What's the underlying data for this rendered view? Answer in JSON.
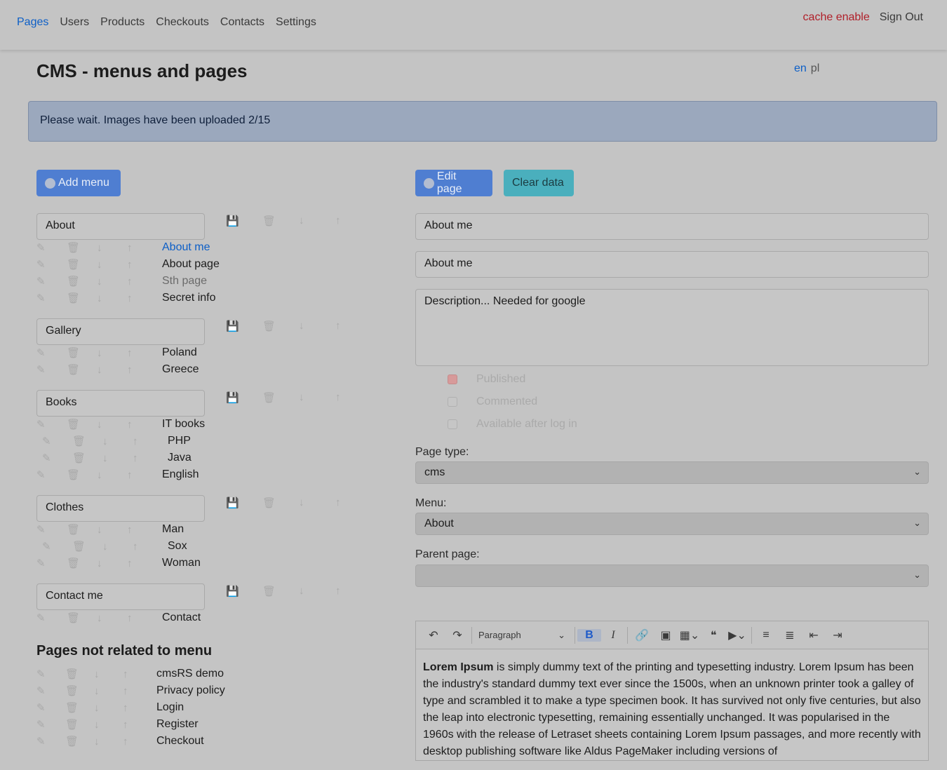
{
  "nav": {
    "items": [
      "Pages",
      "Users",
      "Products",
      "Checkouts",
      "Contacts",
      "Settings"
    ],
    "cache": "cache enable",
    "signout": "Sign Out"
  },
  "title": "CMS - menus and pages",
  "langs": {
    "en": "en",
    "pl": "pl"
  },
  "alert": "Please wait. Images have been uploaded 2/15",
  "buttons": {
    "add_menu": "Add menu",
    "edit_page": "Edit page",
    "clear_data": "Clear data"
  },
  "menus": [
    {
      "name": "About",
      "pages": [
        {
          "label": "About me",
          "style": "link"
        },
        {
          "label": "About page"
        },
        {
          "label": "Sth page",
          "style": "muted"
        },
        {
          "label": "Secret info"
        }
      ]
    },
    {
      "name": "Gallery",
      "pages": [
        {
          "label": "Poland"
        },
        {
          "label": "Greece"
        }
      ]
    },
    {
      "name": "Books",
      "pages": [
        {
          "label": "IT books"
        },
        {
          "label": "PHP",
          "child": true
        },
        {
          "label": "Java",
          "child": true
        },
        {
          "label": "English"
        }
      ]
    },
    {
      "name": "Clothes",
      "pages": [
        {
          "label": "Man"
        },
        {
          "label": "Sox",
          "child": true
        },
        {
          "label": "Woman"
        }
      ]
    },
    {
      "name": "Contact me",
      "pages": [
        {
          "label": "Contact"
        }
      ]
    }
  ],
  "unrelated_title": "Pages not related to menu",
  "unrelated_pages": [
    "cmsRS demo",
    "Privacy policy",
    "Login",
    "Register",
    "Checkout"
  ],
  "form": {
    "title": "About me",
    "short_title": "About me",
    "description": "Description... Needed for google",
    "checks": [
      {
        "label": "Published",
        "checked": true
      },
      {
        "label": "Commented",
        "checked": false
      },
      {
        "label": "Available after log in",
        "checked": false
      }
    ],
    "page_type_label": "Page type:",
    "page_type": "cms",
    "menu_label": "Menu:",
    "menu": "About",
    "parent_label": "Parent page:",
    "parent": ""
  },
  "editor": {
    "paragraph": "Paragraph",
    "bold_lead": "Lorem Ipsum",
    "text": " is simply dummy text of the printing and typesetting industry. Lorem Ipsum has been the industry's standard dummy text ever since the 1500s, when an unknown printer took a galley of type and scrambled it to make a type specimen book. It has survived not only five centuries, but also the leap into electronic typesetting, remaining essentially unchanged. It was popularised in the 1960s with the release of Letraset sheets containing Lorem Ipsum passages, and more recently with desktop publishing software like Aldus PageMaker including versions of"
  },
  "icons": [
    "edit-icon",
    "trash-icon",
    "arrow-down-icon",
    "arrow-up-icon",
    "save-icon"
  ]
}
